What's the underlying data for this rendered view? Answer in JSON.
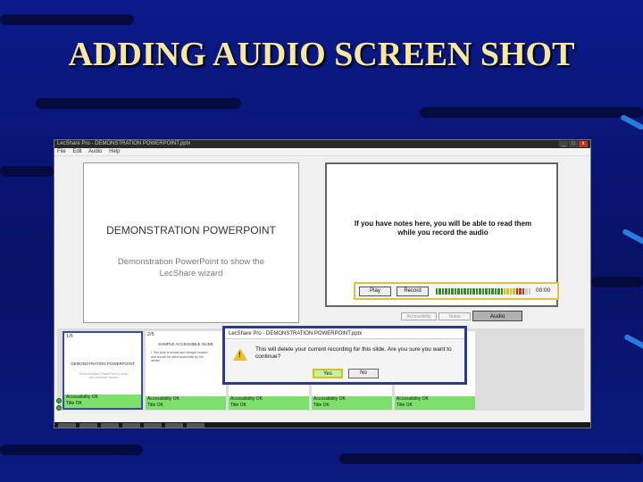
{
  "slide_title": "ADDING AUDIO SCREEN SHOT",
  "window": {
    "title": "LecShare Pro - DEMONSTRATION POWERPOINT.pptx",
    "controls": [
      "_",
      "□",
      "x"
    ]
  },
  "menu": [
    "File",
    "Edit",
    "Audio",
    "Help"
  ],
  "main_slide": {
    "title": "DEMONSTRATION POWERPOINT",
    "subtitle": "Demonstration PowerPoint to show the LecShare wizard"
  },
  "notes": {
    "text": "If you have notes here, you will be able to read them while you record the audio"
  },
  "audio_controls": {
    "play_label": "Play",
    "record_label": "Record",
    "time": "00:00",
    "level_segments": {
      "green": 22,
      "yellow": 4,
      "red": 3,
      "off": 2
    }
  },
  "tabs": {
    "accessibility": "Accessibility",
    "notes": "Notes",
    "audio": "Audio"
  },
  "thumbnails": [
    {
      "num": "1/5",
      "title": "DEMONSTRATION POWERPOINT",
      "body": "Demonstration PowerPoint to show the LecShare wizard",
      "status1": "Accessibility OK",
      "status2": "Title OK"
    },
    {
      "num": "2/5",
      "title": "SAMPLE ACCESSIBLE SLIDE",
      "body": "• This slide is simple and straight forward and should be rated accessible by the wizard",
      "status1": "Accessibility OK",
      "status2": "Title OK"
    },
    {
      "num": "",
      "title": "",
      "body": "",
      "status1": "Accessibility OK",
      "status2": "Title OK"
    },
    {
      "num": "",
      "title": "",
      "body": "",
      "status1": "Accessibility OK",
      "status2": "Title OK"
    },
    {
      "num": "",
      "title": "",
      "body": "",
      "status1": "Accessibility OK",
      "status2": "Title OK"
    }
  ],
  "dialog": {
    "title": "LecShare Pro - DEMONSTRATION POWERPOINT.pptx",
    "message": "This will delete your current recording for this slide.  Are you sure you want to continue?",
    "yes_label": "Yes",
    "no_label": "No",
    "icon": "warning-icon"
  },
  "colors": {
    "background": "#0b1a8a",
    "title": "#f6e8a4",
    "status_ok": "#7de06a",
    "highlight_border": "#e0c040",
    "dialog_border": "#2b3a8e"
  }
}
